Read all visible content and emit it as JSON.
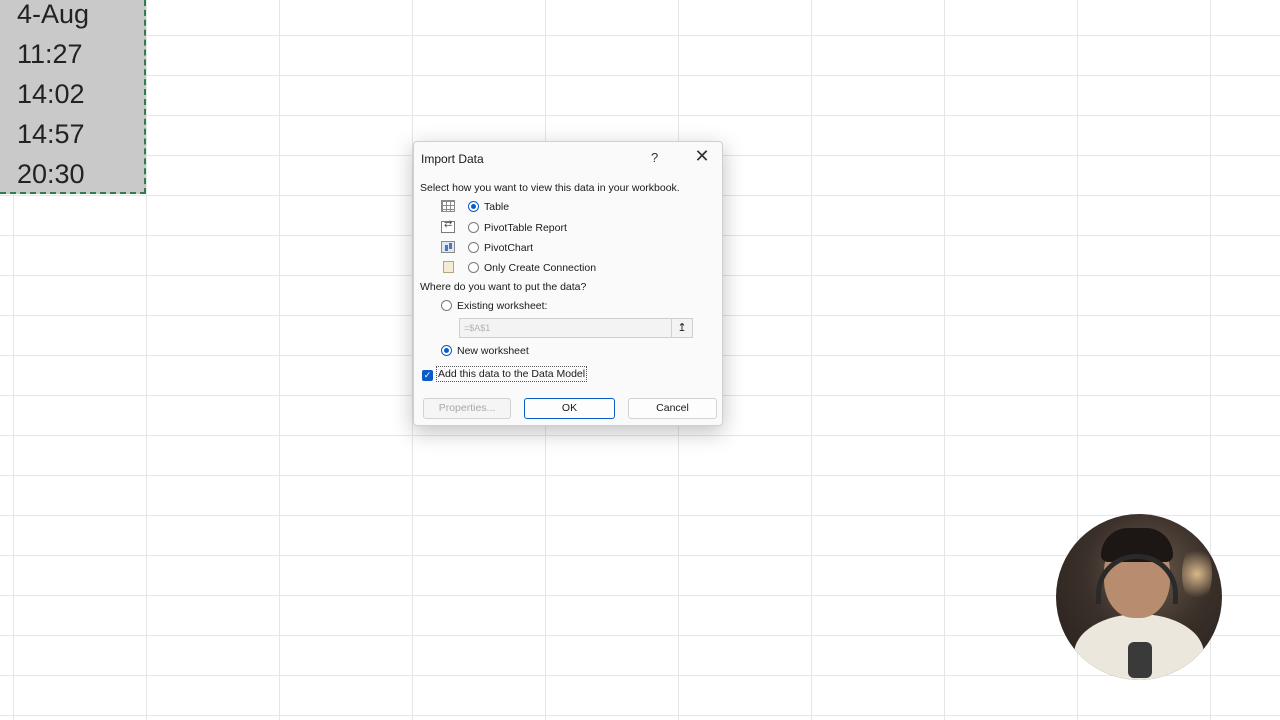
{
  "sheet": {
    "selected_cells": [
      "4-Aug",
      "11:27",
      "14:02",
      "14:57",
      "20:30"
    ]
  },
  "dialog": {
    "title": "Import Data",
    "help_glyph": "?",
    "close_glyph": "✕",
    "view_prompt": "Select how you want to view this data in your workbook.",
    "view_options": [
      {
        "label": "Table",
        "selected": true,
        "icon": "table-icon"
      },
      {
        "label": "PivotTable Report",
        "selected": false,
        "icon": "pivottable-icon"
      },
      {
        "label": "PivotChart",
        "selected": false,
        "icon": "pivotchart-icon"
      },
      {
        "label": "Only Create Connection",
        "selected": false,
        "icon": "connection-icon"
      }
    ],
    "location_prompt": "Where do you want to put the data?",
    "location_options": [
      {
        "label": "Existing worksheet:",
        "selected": false
      },
      {
        "label": "New worksheet",
        "selected": true
      }
    ],
    "range_value": "=$A$1",
    "range_button_glyph": "↥",
    "data_model_label": "Add this data to the Data Model",
    "data_model_checked": true,
    "buttons": {
      "properties": "Properties...",
      "ok": "OK",
      "cancel": "Cancel"
    }
  },
  "colors": {
    "accent": "#0a5cc9",
    "selection_border": "#2f7d4f",
    "selection_fill": "#c9c9c9"
  }
}
